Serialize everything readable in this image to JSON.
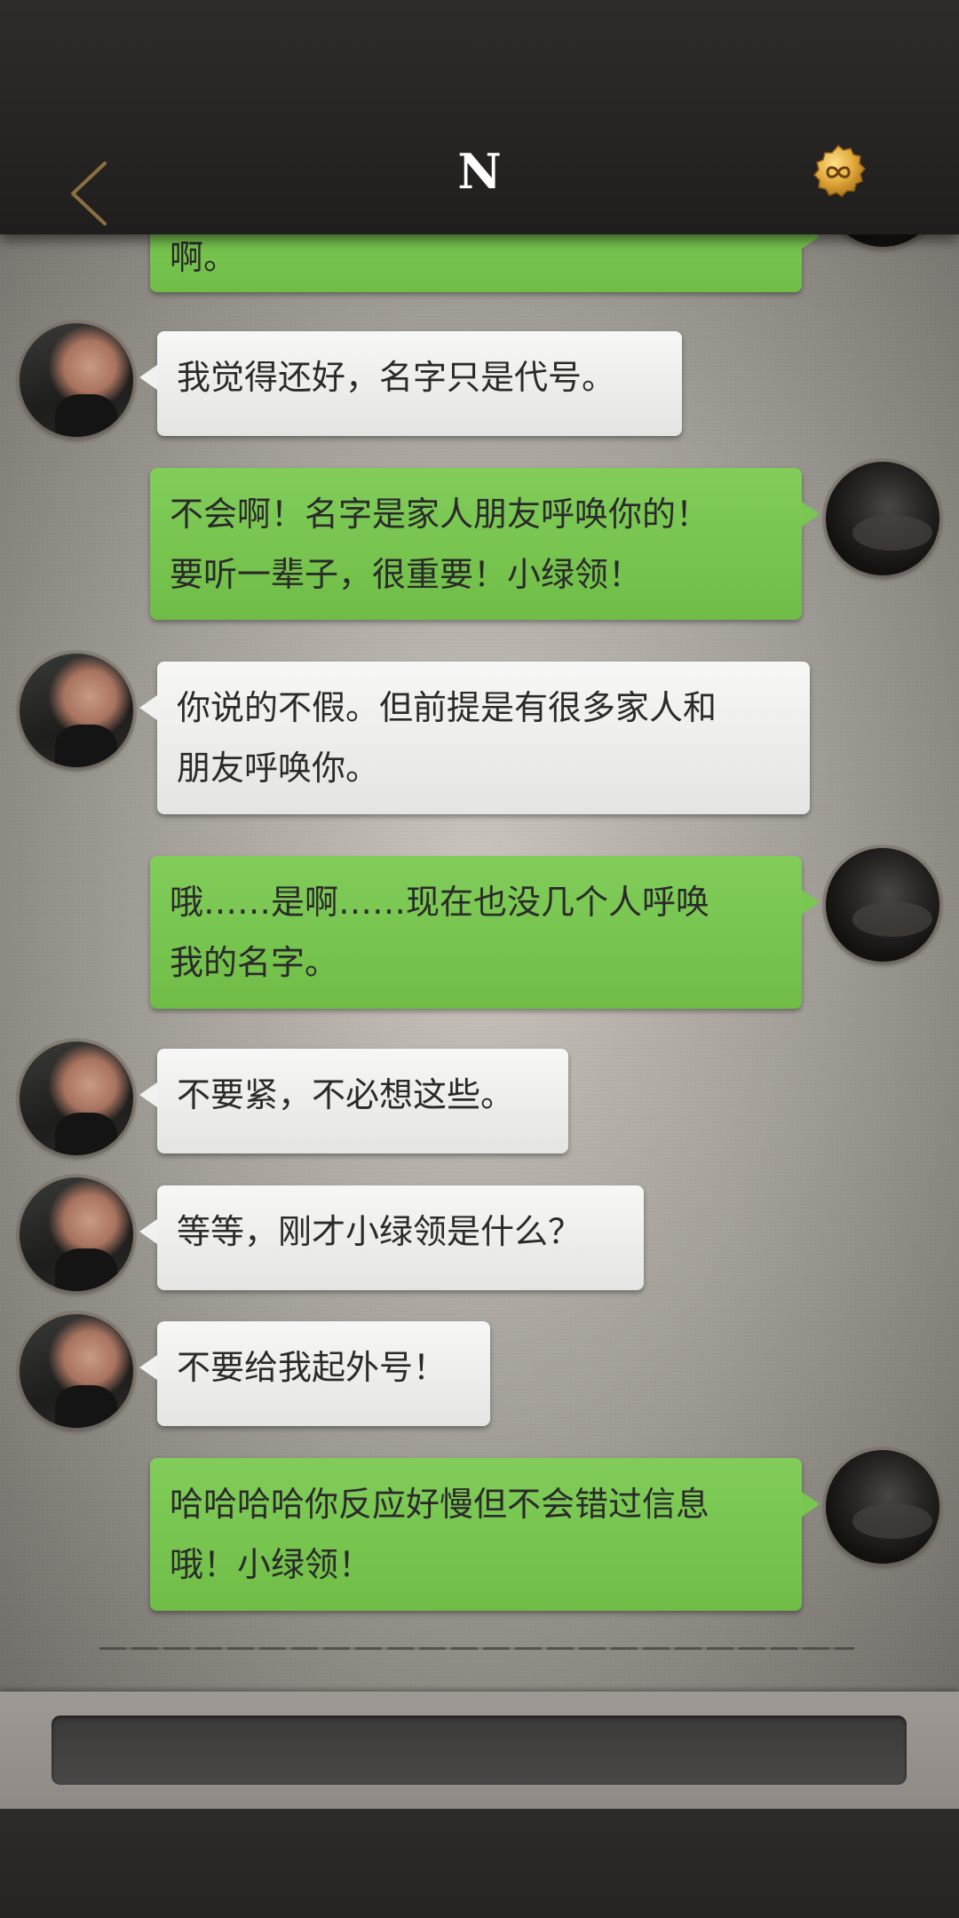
{
  "header": {
    "title": "N",
    "back_icon": "chevron-left-icon",
    "badge_icon": "infinity-badge-icon",
    "back_color": "#8a7040",
    "badge_color": "#d9a93a"
  },
  "messages": [
    {
      "side": "sent",
      "text": "啊。"
    },
    {
      "side": "recv",
      "text": "我觉得还好，名字只是代号。"
    },
    {
      "side": "sent",
      "text": "不会啊！名字是家人朋友呼唤你的！\n要听一辈子，很重要！小绿领！"
    },
    {
      "side": "recv",
      "text": "你说的不假。但前提是有很多家人和\n朋友呼唤你。"
    },
    {
      "side": "sent",
      "text": "哦……是啊……现在也没几个人呼唤\n我的名字。"
    },
    {
      "side": "recv",
      "text": "不要紧，不必想这些。"
    },
    {
      "side": "recv",
      "text": "等等，刚才小绿领是什么？"
    },
    {
      "side": "recv",
      "text": "不要给我起外号！"
    },
    {
      "side": "sent",
      "text": "哈哈哈哈你反应好慢但不会错过信息\n哦！小绿领！"
    }
  ],
  "input": {
    "value": "",
    "placeholder": ""
  },
  "colors": {
    "sent_bubble": "#76c24e",
    "recv_bubble": "#f1f1f0",
    "header": "#262524"
  }
}
